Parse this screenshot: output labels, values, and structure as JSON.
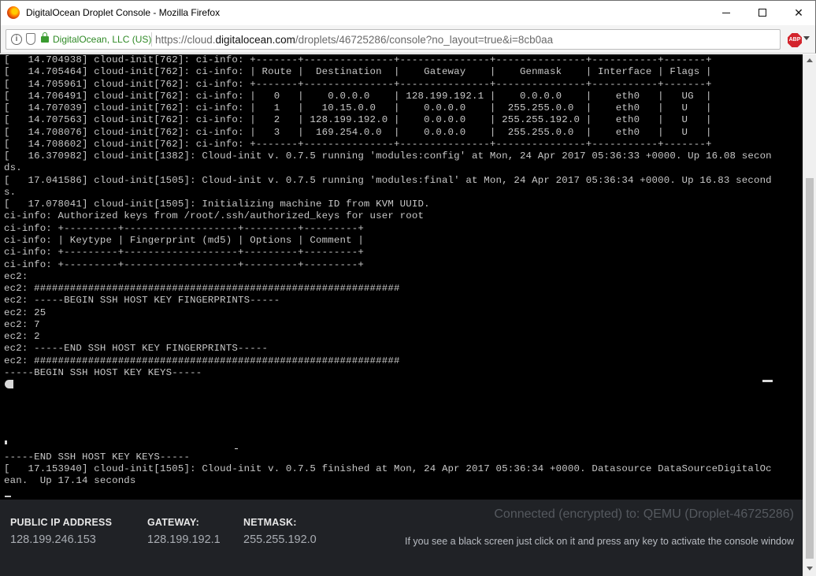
{
  "window": {
    "title": "DigitalOcean Droplet Console - Mozilla Firefox",
    "minimize_label": "minimize",
    "maximize_label": "maximize",
    "close_label": "close"
  },
  "urlbar": {
    "identity": "DigitalOcean, LLC (US)",
    "url_prefix": "https://cloud.",
    "url_domain": "digitalocean.com",
    "url_path": "/droplets/46725286/console?no_layout=true&i=8cb0aa",
    "addon_badge": "ABP"
  },
  "console": {
    "lines": [
      "[   14.704938] cloud-init[762]: ci-info: +-------+---------------+---------------+---------------+-----------+-------+",
      "[   14.705464] cloud-init[762]: ci-info: | Route |  Destination  |    Gateway    |    Genmask    | Interface | Flags |",
      "[   14.705961] cloud-init[762]: ci-info: +-------+---------------+---------------+---------------+-----------+-------+",
      "[   14.706491] cloud-init[762]: ci-info: |   0   |    0.0.0.0    | 128.199.192.1 |    0.0.0.0    |    eth0   |   UG  |",
      "[   14.707039] cloud-init[762]: ci-info: |   1   |   10.15.0.0   |    0.0.0.0    |  255.255.0.0  |    eth0   |   U   |",
      "[   14.707563] cloud-init[762]: ci-info: |   2   | 128.199.192.0 |    0.0.0.0    | 255.255.192.0 |    eth0   |   U   |",
      "[   14.708076] cloud-init[762]: ci-info: |   3   |  169.254.0.0  |    0.0.0.0    |  255.255.0.0  |    eth0   |   U   |",
      "[   14.708602] cloud-init[762]: ci-info: +-------+---------------+---------------+---------------+-----------+-------+",
      "[   16.370982] cloud-init[1382]: Cloud-init v. 0.7.5 running 'modules:config' at Mon, 24 Apr 2017 05:36:33 +0000. Up 16.08 secon",
      "ds.",
      "[   17.041586] cloud-init[1505]: Cloud-init v. 0.7.5 running 'modules:final' at Mon, 24 Apr 2017 05:36:34 +0000. Up 16.83 second",
      "s.",
      "[   17.078041] cloud-init[1505]: Initializing machine ID from KVM UUID.",
      "ci-info: Authorized keys from /root/.ssh/authorized_keys for user root",
      "ci-info: +---------+-------------------+---------+---------+",
      "ci-info: | Keytype | Fingerprint (md5) | Options | Comment |",
      "ci-info: +---------+-------------------+---------+---------+",
      "ci-info: +---------+-------------------+---------+---------+",
      "ec2:",
      "ec2: #############################################################",
      "ec2: -----BEGIN SSH HOST KEY FINGERPRINTS-----",
      "ec2: 25",
      "ec2: 7",
      "ec2: 2",
      "ec2: -----END SSH HOST KEY FINGERPRINTS-----",
      "ec2: #############################################################",
      "-----BEGIN SSH HOST KEY KEYS-----",
      "",
      "",
      "",
      "",
      "",
      "",
      "-----END SSH HOST KEY KEYS-----",
      "[   17.153940] cloud-init[1505]: Cloud-init v. 0.7.5 finished at Mon, 24 Apr 2017 05:36:34 +0000. Datasource DataSourceDigitalOc",
      "ean.  Up 17.14 seconds"
    ]
  },
  "footer": {
    "public_ip_label": "PUBLIC IP ADDRESS",
    "public_ip_value": "128.199.246.153",
    "gateway_label": "GATEWAY:",
    "gateway_value": "128.199.192.1",
    "netmask_label": "NETMASK:",
    "netmask_value": "255.255.192.0",
    "connection_status": "Connected (encrypted) to: QEMU (Droplet-46725286)",
    "hint": "If you see a black screen just click on it and press any key to activate the console window"
  }
}
